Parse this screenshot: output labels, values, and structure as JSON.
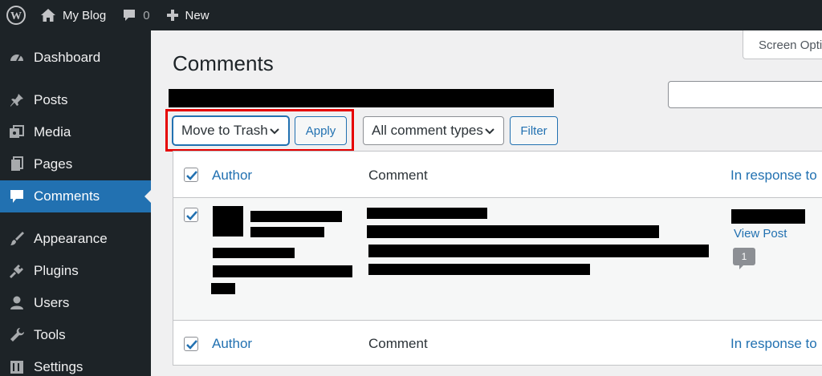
{
  "adminbar": {
    "site_name": "My Blog",
    "comments_count": "0",
    "new_label": "New"
  },
  "sidebar": {
    "items": [
      {
        "label": "Dashboard",
        "icon": "dashboard-icon"
      },
      {
        "label": "Posts",
        "icon": "pushpin-icon"
      },
      {
        "label": "Media",
        "icon": "media-icon"
      },
      {
        "label": "Pages",
        "icon": "pages-icon"
      },
      {
        "label": "Comments",
        "icon": "comment-bubble-icon",
        "current": true
      },
      {
        "label": "Appearance",
        "icon": "paintbrush-icon"
      },
      {
        "label": "Plugins",
        "icon": "plug-icon"
      },
      {
        "label": "Users",
        "icon": "user-icon"
      },
      {
        "label": "Tools",
        "icon": "wrench-icon"
      },
      {
        "label": "Settings",
        "icon": "settings-icon"
      }
    ]
  },
  "screen_options_label": "Screen Opti",
  "page_title": "Comments",
  "bulk_actions": {
    "selected": "Move to Trash",
    "apply_label": "Apply"
  },
  "comment_type_filter": {
    "selected": "All comment types",
    "filter_label": "Filter"
  },
  "table": {
    "columns": {
      "author": "Author",
      "comment": "Comment",
      "in_response_to": "In response to"
    },
    "rows": [
      {
        "checked": true,
        "view_post_label": "View Post",
        "comment_count": "1"
      }
    ]
  },
  "colors": {
    "admin_dark": "#1d2327",
    "accent": "#2271b1",
    "highlight": "#e60000"
  }
}
